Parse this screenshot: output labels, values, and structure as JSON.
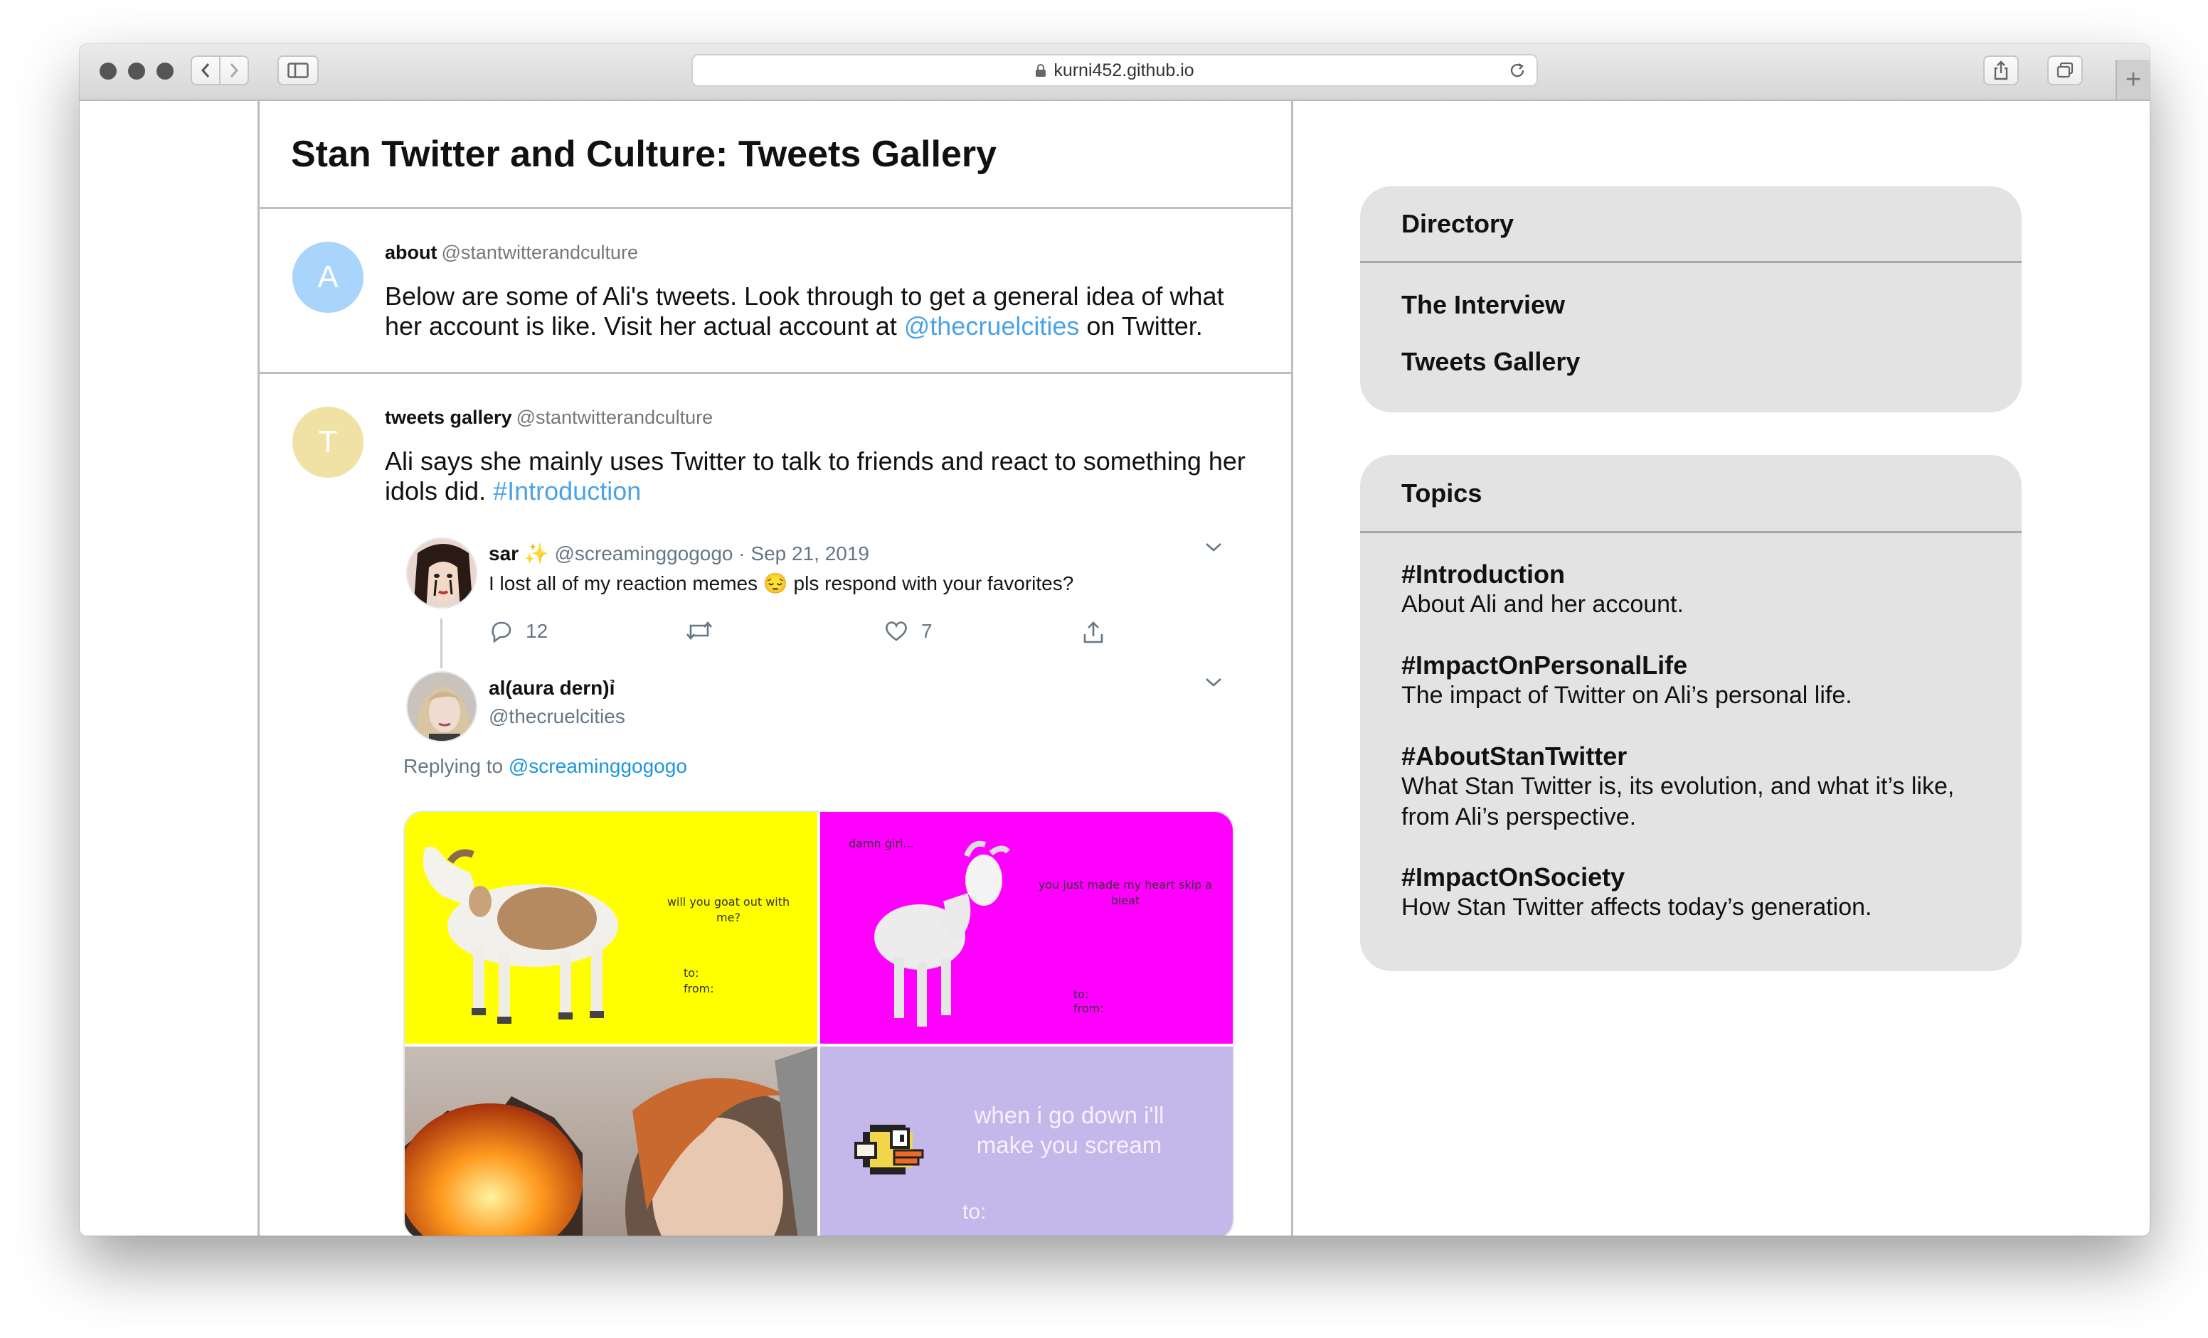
{
  "browser": {
    "url": "kurni452.github.io"
  },
  "page": {
    "title": "Stan Twitter and Culture: Tweets Gallery"
  },
  "posts": {
    "about": {
      "avatar_letter": "A",
      "name": "about",
      "handle": "@stantwitterandculture",
      "text_before": "Below are some of Ali's tweets. Look through to get a general idea of what her account is like. Visit her actual account at ",
      "link": "@thecruelcities",
      "text_after": " on Twitter."
    },
    "gallery": {
      "avatar_letter": "T",
      "name": "tweets gallery",
      "handle": "@stantwitterandculture",
      "text_before": "Ali says she mainly uses Twitter to talk to friends and react to something her idols did. ",
      "hashtag": "#Introduction"
    }
  },
  "embed": {
    "original": {
      "name": "sar",
      "emoji": "✨",
      "handle": "@screaminggogogo",
      "separator": "·",
      "date": "Sep 21, 2019",
      "text_before": "I lost all of my reaction memes ",
      "emoji_face": "😔",
      "text_after": " pls respond with your favorites?",
      "replies": "12",
      "likes": "7"
    },
    "reply": {
      "name": "al(aura dern)",
      "name_suffix": "ỉ",
      "handle": "@thecruelcities",
      "replying_prefix": "Replying to ",
      "replying_to": "@screaminggogogo"
    },
    "memes": {
      "goat1": {
        "text": "will you goat out with me?",
        "to": "to:",
        "from": "from:"
      },
      "goat2": {
        "top": "damn girl...",
        "text": "you just made my heart skip a bleat",
        "to": "to:",
        "from": "from:"
      },
      "bird": {
        "text_line1": "when i go down i'll",
        "text_line2": "make you scream",
        "to": "to:"
      }
    }
  },
  "sidebar": {
    "directory": {
      "title": "Directory",
      "links": [
        "The Interview",
        "Tweets Gallery"
      ]
    },
    "topics": {
      "title": "Topics",
      "items": [
        {
          "tag": "#Introduction",
          "desc": "About Ali and her account."
        },
        {
          "tag": "#ImpactOnPersonalLife",
          "desc": "The impact of Twitter on Ali’s personal life."
        },
        {
          "tag": "#AboutStanTwitter",
          "desc": "What Stan Twitter is, its evolution, and what it’s like, from Ali’s perspective."
        },
        {
          "tag": "#ImpactOnSociety",
          "desc": "How Stan Twitter affects today’s generation."
        }
      ]
    }
  },
  "colors": {
    "link": "#4aa3e8",
    "avatar_a": "#a9d4fb",
    "avatar_t": "#f0e2a4",
    "card_bg": "#e3e3e3",
    "meme_yellow": "#ffff00",
    "meme_magenta": "#ff00ff",
    "meme_lavender": "#c4b8ea"
  }
}
